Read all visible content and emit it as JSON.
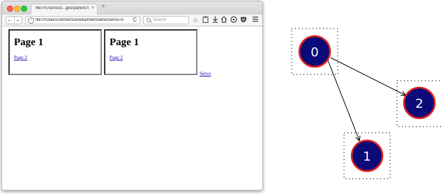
{
  "browser": {
    "tab_title": "file:///Users/co...ges/parent.html",
    "tab_close": "×",
    "new_tab": "+",
    "url": "file:///Users/connor/Development/servo/servo-navi",
    "search_placeholder": "Search",
    "nav_back": "←",
    "nav_forward": "→",
    "reload": "C",
    "info": "i"
  },
  "page": {
    "frames": [
      {
        "heading": "Page 1",
        "link": "Page 2"
      },
      {
        "heading": "Page 1",
        "link": "Page 2"
      }
    ],
    "servo_link": "Servo"
  },
  "graph": {
    "nodes": [
      "0",
      "1",
      "2"
    ],
    "edges": [
      [
        "0",
        "1"
      ],
      [
        "0",
        "2"
      ]
    ],
    "node_fill": "#0a0a78",
    "node_stroke": "#e02020"
  },
  "colors": {
    "link": "#1a0dab",
    "close": "#fc5f57",
    "minimize": "#fdbd2d",
    "maximize": "#2ac940"
  }
}
